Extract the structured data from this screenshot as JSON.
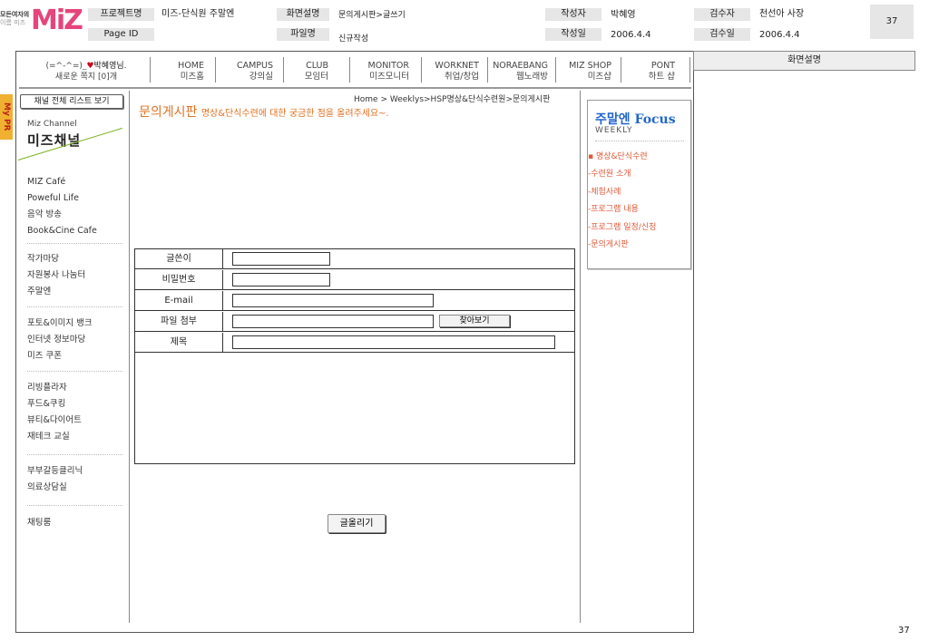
{
  "doc_header": {
    "logo_small_1": "모든여자의",
    "logo_small_2": "이름",
    "logo_small_3": "미즈",
    "logo_text": "MiZ",
    "project_label": "프로젝트명",
    "project_value": "미즈-단식원 주말엔",
    "page_id_label": "Page ID",
    "page_id_value": "",
    "screen_desc_label": "화면설명",
    "screen_desc_value": "문의게시판>글쓰기",
    "file_name_label": "파일명",
    "file_name_value": "신규작성",
    "author_label": "작성자",
    "author_value": "박혜영",
    "date_label": "작성일",
    "date_value": "2006.4.4",
    "reviewer_label": "검수자",
    "reviewer_value": "천선아 사장",
    "review_date_label": "검수일",
    "review_date_value": "2006.4.4",
    "page_number": "37"
  },
  "welcome": {
    "line1_prefix": "(=^-^=)_",
    "heart": "♥",
    "line1_name": "박혜영님.",
    "line2": "새로운 쪽지 [0]개"
  },
  "topnav": [
    {
      "en": "HOME",
      "ko": "미즈홈"
    },
    {
      "en": "CAMPUS",
      "ko": "강의실"
    },
    {
      "en": "CLUB",
      "ko": "모임터"
    },
    {
      "en": "MONITOR",
      "ko": "미즈모니터"
    },
    {
      "en": "WORKNET",
      "ko": "취업/창업"
    },
    {
      "en": "NORAEBANG",
      "ko": "웹노래방"
    },
    {
      "en": "MIZ SHOP",
      "ko": "미즈샵"
    },
    {
      "en": "PONT",
      "ko": "하트 샵"
    }
  ],
  "my_pr": "My PR",
  "sidebar": {
    "channel_list_button": "채널 전체 리스트 보기",
    "miz_channel_en": "Miz Channel",
    "miz_channel_ko": "미즈채널",
    "groups": [
      [
        "MIZ Café",
        "Poweful Life",
        "음악 방송",
        "Book&Cine Cafe"
      ],
      [
        "작가마당",
        "자원봉사 나눔터",
        "주말엔"
      ],
      [
        "포토&이미지 뱅크",
        "인터넷 정보마당",
        "미즈 쿠폰"
      ],
      [
        "리빙플라자",
        "푸드&쿠킹",
        "뷰티&다이어트",
        "재테크 교실"
      ],
      [
        "부부갈등클리닉",
        "의료상담실"
      ],
      [
        "채팅룸"
      ]
    ]
  },
  "content": {
    "breadcrumb": "Home > Weeklys>HSP명상&단식수련원>문의게시판",
    "title": "문의게시판",
    "subtitle": "명상&단식수련에 대한 궁금한 점을 올려주세요~.",
    "form": {
      "author_label": "글쓴이",
      "password_label": "비밀번호",
      "email_label": "E-mail",
      "file_label": "파일 첨부",
      "find_button": "찾아보기",
      "subject_label": "제목"
    },
    "submit_button": "글올리기"
  },
  "focus": {
    "title_ko": "주말엔",
    "title_en": "Focus",
    "weekly": "WEEKLY",
    "items": [
      "▪ 명상&단식수련",
      "-수련원 소개",
      "-체험사례",
      "-프로그램 내용",
      "-프로그램 일정/신청",
      "-문의게시판"
    ]
  },
  "right_panel": {
    "title": "화면설명"
  },
  "footer_page_number": "37"
}
